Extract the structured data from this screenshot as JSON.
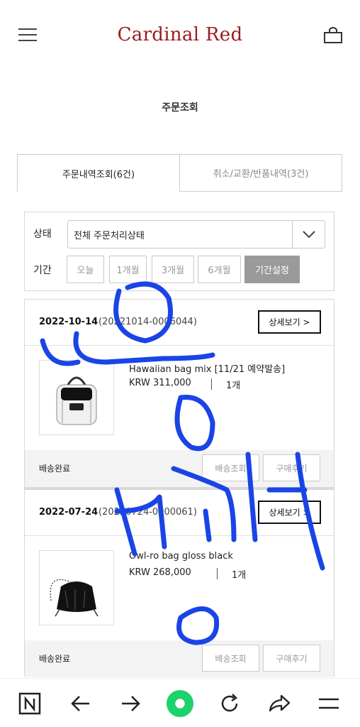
{
  "header": {
    "brand": "Cardinal Red"
  },
  "page": {
    "title": "주문조회"
  },
  "tabs": [
    {
      "label": "주문내역조회(6건)",
      "active": true
    },
    {
      "label": "취소/교환/반품내역(3건)",
      "active": false
    }
  ],
  "filter": {
    "status_label": "상태",
    "status_value": "전체 주문처리상태",
    "period_label": "기간",
    "periods": [
      "오늘",
      "1개월",
      "3개월",
      "6개월",
      "기간설정"
    ],
    "selected_period": "기간설정"
  },
  "orders": [
    {
      "date": "2022-10-14",
      "number": "(20221014-0006044)",
      "detail_label": "상세보기 >",
      "product_name": "Hawaiian bag mix [11/21 예약발송]",
      "price": "KRW 311,000",
      "qty": "1개",
      "status": "배송완료",
      "track_label": "배송조회",
      "review_label": "구매후기"
    },
    {
      "date": "2022-07-24",
      "number": "(20220724-0000061)",
      "detail_label": "상세보기 >",
      "product_name": "Owl-ro bag gloss black",
      "price": "KRW 268,000",
      "qty": "1개",
      "status": "배송완료",
      "track_label": "배송조회",
      "review_label": "구매후기"
    }
  ],
  "colors": {
    "brand": "#9b1b1e",
    "scribble": "#1a44e6",
    "nav_accent": "#1dd26b"
  }
}
